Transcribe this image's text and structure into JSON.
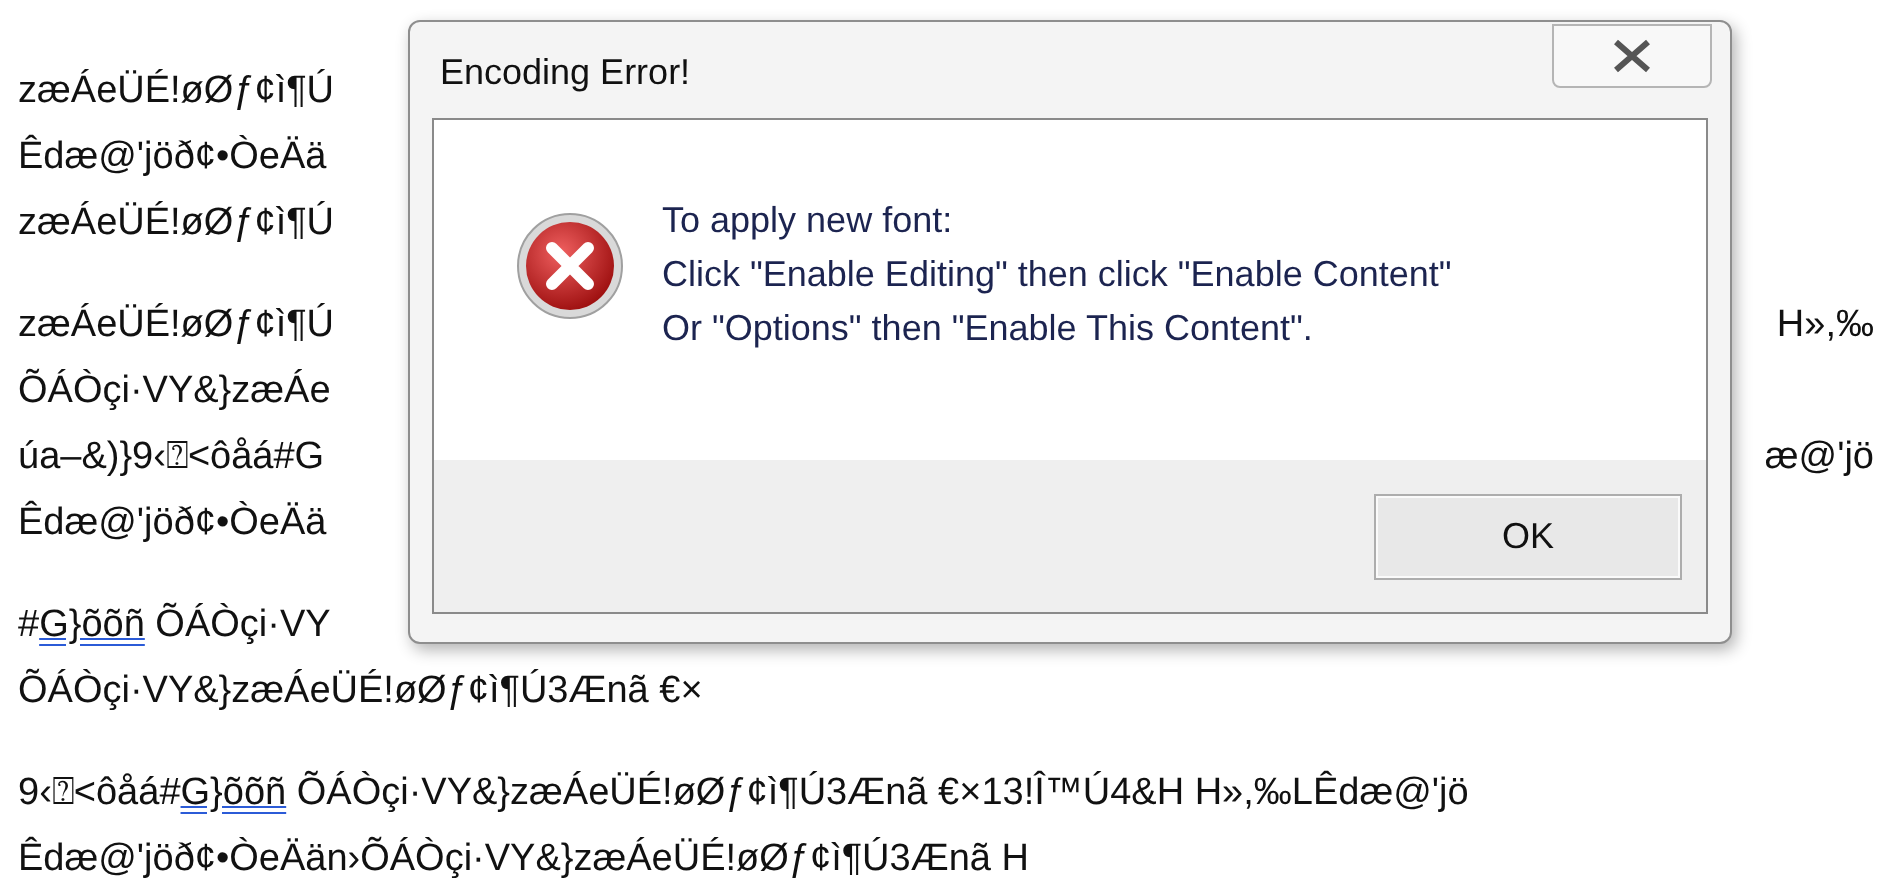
{
  "document": {
    "paragraphs": [
      {
        "lines": [
          {
            "segments": [
              {
                "text": "zæÁeÜÉ!øØƒ¢ì¶Ú",
                "flagged": false
              }
            ]
          },
          {
            "segments": [
              {
                "text": "Êdæ@'jöð¢•ÒeÄä",
                "flagged": false
              }
            ]
          },
          {
            "segments": [
              {
                "text": "zæÁeÜÉ!øØƒ¢ì¶Ú",
                "flagged": false
              }
            ]
          }
        ]
      },
      {
        "lines": [
          {
            "segments": [
              {
                "text": "zæÁeÜÉ!øØƒ¢ì¶Ú",
                "flagged": false
              }
            ],
            "right": "H»,‰"
          },
          {
            "segments": [
              {
                "text": "ÕÁÒçi·VY&}zæÁe",
                "flagged": false
              }
            ]
          },
          {
            "segments": [
              {
                "text": "úa–&)}9‹⍰<ôåá#G",
                "flagged": false
              }
            ],
            "right": "æ@'jö"
          },
          {
            "segments": [
              {
                "text": "Êdæ@'jöð¢•ÒeÄä",
                "flagged": false
              }
            ]
          }
        ]
      },
      {
        "lines": [
          {
            "segments": [
              {
                "text": "#",
                "flagged": false
              },
              {
                "text": "G}õõñ",
                "flagged": true
              },
              {
                "text": " ÕÁÒçi·VY",
                "flagged": false
              }
            ]
          },
          {
            "segments": [
              {
                "text": "ÕÁÒçi·VY&}zæÁeÜÉ!øØƒ¢ì¶Ú3Ænã €×",
                "flagged": false
              }
            ]
          }
        ]
      },
      {
        "lines": [
          {
            "segments": [
              {
                "text": "9‹⍰<ôåá#",
                "flagged": false
              },
              {
                "text": "G}õõñ",
                "flagged": true
              },
              {
                "text": " ÕÁÒçi·VY&}zæÁeÜÉ!øØƒ¢ì¶Ú3Ænã €×13!Î™Ú4&H H»,‰LÊdæ@'jö",
                "flagged": false
              }
            ]
          },
          {
            "segments": [
              {
                "text": "Êdæ@'jöð¢•ÒeÄän›ÕÁÒçi·VY&}zæÁeÜÉ!øØƒ¢ì¶Ú3Ænã H",
                "flagged": false
              }
            ]
          }
        ]
      }
    ]
  },
  "dialog": {
    "title": "Encoding Error!",
    "message": [
      "To apply new font:",
      "Click \"Enable Editing\" then click \"Enable Content\"",
      "Or \"Options\" then \"Enable This Content\"."
    ],
    "buttons": [
      "OK"
    ]
  }
}
